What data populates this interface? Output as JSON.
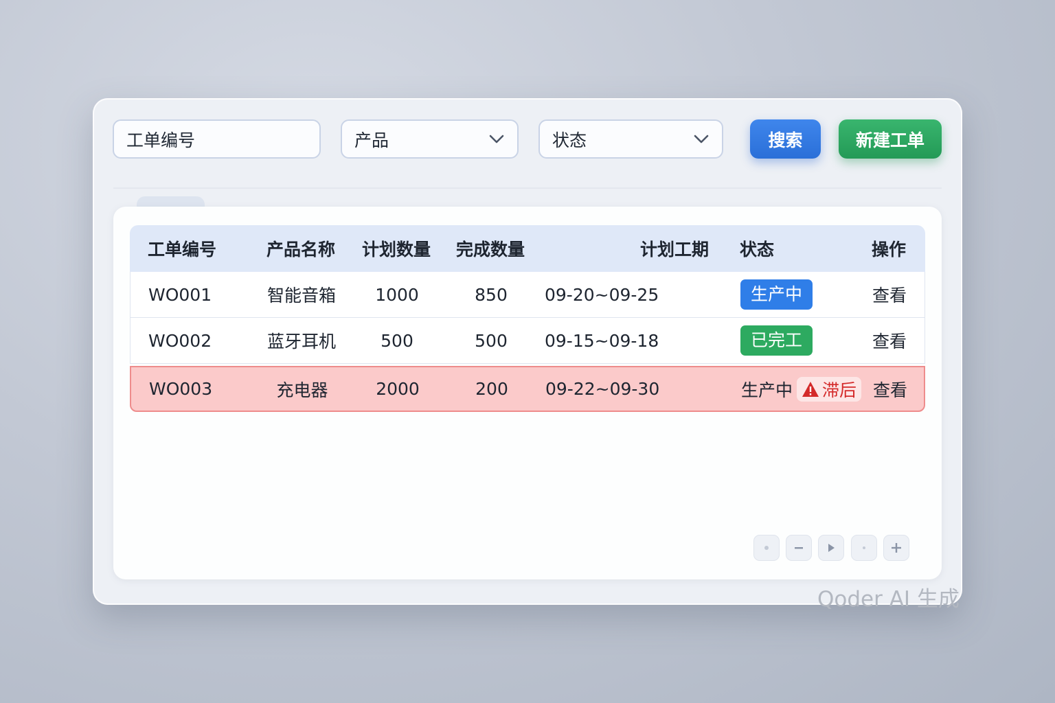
{
  "filters": {
    "order_no_placeholder": "工单编号",
    "product_select": "产品",
    "status_select": "状态"
  },
  "actions": {
    "search_label": "搜索",
    "new_label": "新建工单"
  },
  "table": {
    "headers": [
      "工单编号",
      "产品名称",
      "计划数量",
      "完成数量",
      "计划工期",
      "状态",
      "操作"
    ],
    "rows": [
      {
        "id": "WO001",
        "product": "智能音箱",
        "planned": "1000",
        "done": "850",
        "period": "09-20~09-25",
        "status": "生产中",
        "action": "查看"
      },
      {
        "id": "WO002",
        "product": "蓝牙耳机",
        "planned": "500",
        "done": "500",
        "period": "09-15~09-18",
        "status": "已完工",
        "action": "查看"
      },
      {
        "id": "WO003",
        "product": "充电器",
        "planned": "2000",
        "done": "200",
        "period": "09-22~09-30",
        "status": "生产中",
        "late_label": "滞后",
        "action": "查看"
      }
    ]
  },
  "watermark": "Qoder AI 生成",
  "colors": {
    "primary": "#2f7ee8",
    "success": "#2daa60",
    "danger": "#d42a2a",
    "alert_row": "#fbcaca"
  },
  "icons": [
    "chevron-down-icon",
    "warning-icon",
    "minus-icon",
    "play-icon",
    "plus-icon"
  ]
}
